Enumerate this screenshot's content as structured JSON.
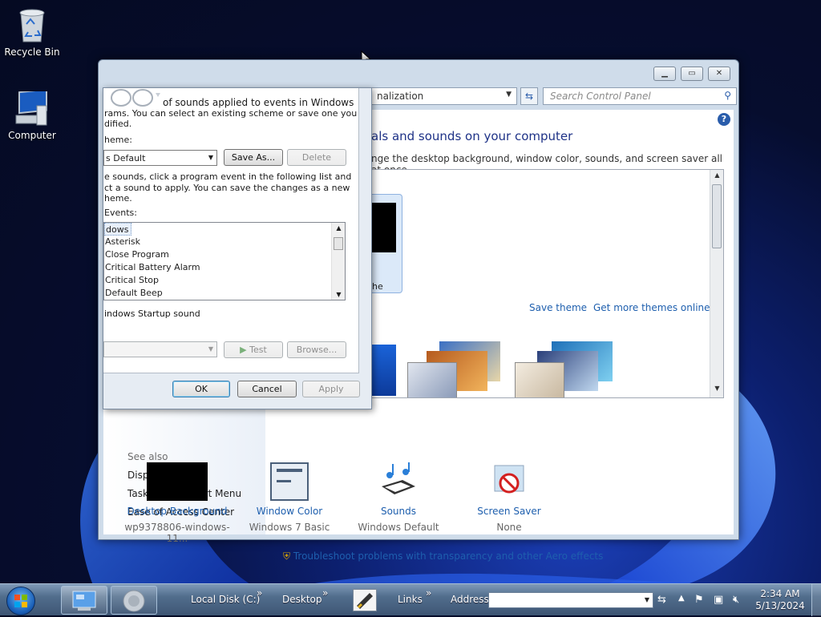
{
  "desktop": {
    "icons": [
      {
        "label": "Recycle Bin"
      },
      {
        "label": "Computer"
      }
    ]
  },
  "control_panel": {
    "address_text": "nalization",
    "search_placeholder": "Search Control Panel",
    "heading": "als and sounds on your computer",
    "subheading": "nge the desktop background, window color, sounds, and screen saver all at once.",
    "selected_theme_label": "he",
    "theme_links": {
      "save": "Save theme",
      "more": "Get more themes online"
    },
    "bottom_items": [
      {
        "title": "Desktop Background",
        "value": "wp9378806-windows-11..."
      },
      {
        "title": "Window Color",
        "value": "Windows 7 Basic"
      },
      {
        "title": "Sounds",
        "value": "Windows Default"
      },
      {
        "title": "Screen Saver",
        "value": "None"
      }
    ],
    "troubleshoot_link": "Troubleshoot problems with transparency and other Aero effects",
    "see_also": {
      "header": "See also",
      "items": [
        "Display",
        "Taskbar and Start Menu",
        "Ease of Access Center"
      ]
    }
  },
  "sound_dialog": {
    "description_line1": "of sounds applied to events in Windows",
    "description_line2": "rams.  You can select an existing scheme or save one you",
    "description_line3": "dified.",
    "scheme_label": "heme:",
    "scheme_value": "s Default",
    "save_as_label": "Save As...",
    "delete_label": "Delete",
    "instructions_line1": "e sounds, click a program event in the following list and",
    "instructions_line2": "ct a sound to apply.  You can save the changes as a new",
    "instructions_line3": "heme.",
    "events_label": "Events:",
    "events": [
      "dows",
      "Asterisk",
      "Close Program",
      "Critical Battery Alarm",
      "Critical Stop",
      "Default Beep"
    ],
    "startup_sound_label": "indows Startup sound",
    "test_label": "Test",
    "browse_label": "Browse...",
    "ok_label": "OK",
    "cancel_label": "Cancel",
    "apply_label": "Apply"
  },
  "taskbar": {
    "toolbars": [
      "Local Disk (C:)",
      "Desktop",
      "Links"
    ],
    "address_label": "Address",
    "address_value": "",
    "time": "2:34 AM",
    "date": "5/13/2024"
  },
  "colors": {
    "link": "#1e5fae",
    "heading": "#1e3287",
    "taskbar": "#516d8c"
  }
}
